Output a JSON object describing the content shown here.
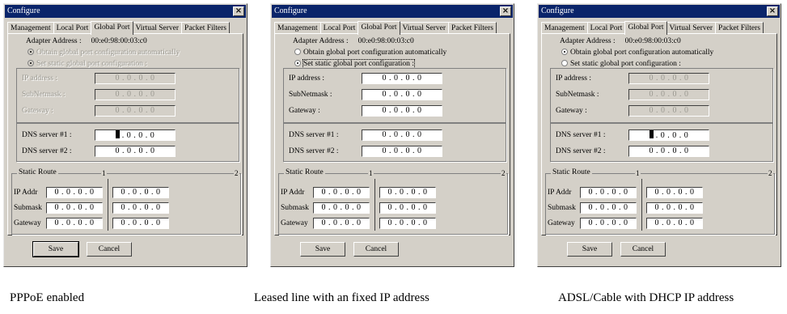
{
  "windows": [
    {
      "title": "Configure",
      "tabs": [
        "Management",
        "Local Port",
        "Global Port",
        "Virtual Server",
        "Packet Filters"
      ],
      "adapter_label": "Adapter Address :",
      "adapter_value": "00:e0:98:00:03:c0",
      "radio_auto": "Obtain global port configuration automatically",
      "radio_static": "Set static global port configuration :",
      "ip_label": "IP address :",
      "ip_value": "0 . 0 . 0 . 0",
      "subnet_label": "SubNetmask :",
      "subnet_value": "0 . 0 . 0 . 0",
      "gateway_label": "Gateway :",
      "gateway_value": "0 . 0 . 0 . 0",
      "dns1_label": "DNS server #1 :",
      "dns1_value": ". 0 . 0 . 0",
      "dns2_label": "DNS server #2 :",
      "dns2_value": "0 . 0 . 0 . 0",
      "route_title": "Static Route",
      "route_col1": "1",
      "route_col2": "2",
      "route_ip_label": "IP Addr",
      "route_mask_label": "Submask",
      "route_gw_label": "Gateway",
      "route_value": "0 . 0 . 0 . 0",
      "save_label": "Save",
      "cancel_label": "Cancel",
      "caption": "PPPoE enabled"
    },
    {
      "title": "Configure",
      "tabs": [
        "Management",
        "Local Port",
        "Global Port",
        "Virtual Server",
        "Packet Filters"
      ],
      "adapter_label": "Adapter Address :",
      "adapter_value": "00:e0:98:00:03:c0",
      "radio_auto": "Obtain global port configuration automatically",
      "radio_static": "Set static global port configuration :",
      "ip_label": "IP address :",
      "ip_value": "0 . 0 . 0 . 0",
      "subnet_label": "SubNetmask :",
      "subnet_value": "0 . 0 . 0 . 0",
      "gateway_label": "Gateway :",
      "gateway_value": "0 . 0 . 0 . 0",
      "dns1_label": "DNS server #1 :",
      "dns1_value": "0 . 0 . 0 . 0",
      "dns2_label": "DNS server #2 :",
      "dns2_value": "0 . 0 . 0 . 0",
      "route_title": "Static Route",
      "route_col1": "1",
      "route_col2": "2",
      "route_ip_label": "IP Addr",
      "route_mask_label": "Submask",
      "route_gw_label": "Gateway",
      "route_value": "0 . 0 . 0 . 0",
      "save_label": "Save",
      "cancel_label": "Cancel",
      "caption": "Leased line with an fixed IP address"
    },
    {
      "title": "Configure",
      "tabs": [
        "Management",
        "Local Port",
        "Global Port",
        "Virtual Server",
        "Packet Filters"
      ],
      "adapter_label": "Adapter Address :",
      "adapter_value": "00:e0:98:00:03:c0",
      "radio_auto": "Obtain global port configuration automatically",
      "radio_static": "Set static global port configuration :",
      "ip_label": "IP address :",
      "ip_value": "0 . 0 . 0 . 0",
      "subnet_label": "SubNetmask :",
      "subnet_value": "0 . 0 . 0 . 0",
      "gateway_label": "Gateway :",
      "gateway_value": "0 . 0 . 0 . 0",
      "dns1_label": "DNS server #1 :",
      "dns1_value": ". 0 . 0 . 0",
      "dns2_label": "DNS server #2 :",
      "dns2_value": "0 . 0 . 0 . 0",
      "route_title": "Static Route",
      "route_col1": "1",
      "route_col2": "2",
      "route_ip_label": "IP Addr",
      "route_mask_label": "Submask",
      "route_gw_label": "Gateway",
      "route_value": "0 . 0 . 0 . 0",
      "save_label": "Save",
      "cancel_label": "Cancel",
      "caption": "ADSL/Cable with DHCP IP address"
    }
  ],
  "colors": {
    "dialog_bg": "#d4d0c8",
    "titlebar": "#0a246a",
    "disabled_text": "#9a9890"
  }
}
